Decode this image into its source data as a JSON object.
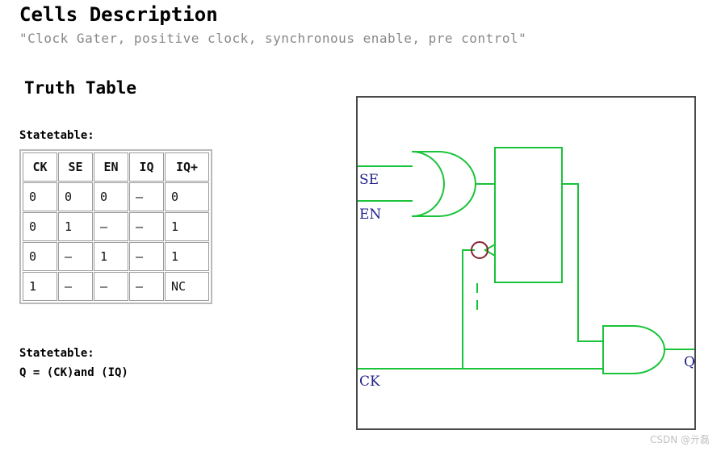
{
  "page": {
    "title": "Cells Description",
    "subtitle": "\"Clock Gater, positive clock, synchronous enable, pre control\"",
    "section_title": "Truth Table",
    "statetable_label": "Statetable:",
    "statetable_label2": "Statetable:",
    "equation": "Q = (CK)and (IQ)",
    "watermark": "CSDN @亓磊"
  },
  "truth_table": {
    "headers": [
      "CK",
      "SE",
      "EN",
      "IQ",
      "IQ+"
    ],
    "rows": [
      [
        "0",
        "0",
        "0",
        "–",
        "0"
      ],
      [
        "0",
        "1",
        "–",
        "–",
        "1"
      ],
      [
        "0",
        "–",
        "1",
        "–",
        "1"
      ],
      [
        "1",
        "–",
        "–",
        "–",
        "NC"
      ]
    ]
  },
  "schematic": {
    "input_labels": [
      "SE",
      "EN",
      "CK"
    ],
    "output_labels": [
      "Q"
    ],
    "gates": [
      "or-gate",
      "latch",
      "and-gate",
      "inverting-clock-bubble"
    ],
    "wire_color": "#19c33a",
    "label_color": "#22228b",
    "bubble_color": "#8b2233",
    "border_color": "#4a4a4a"
  }
}
